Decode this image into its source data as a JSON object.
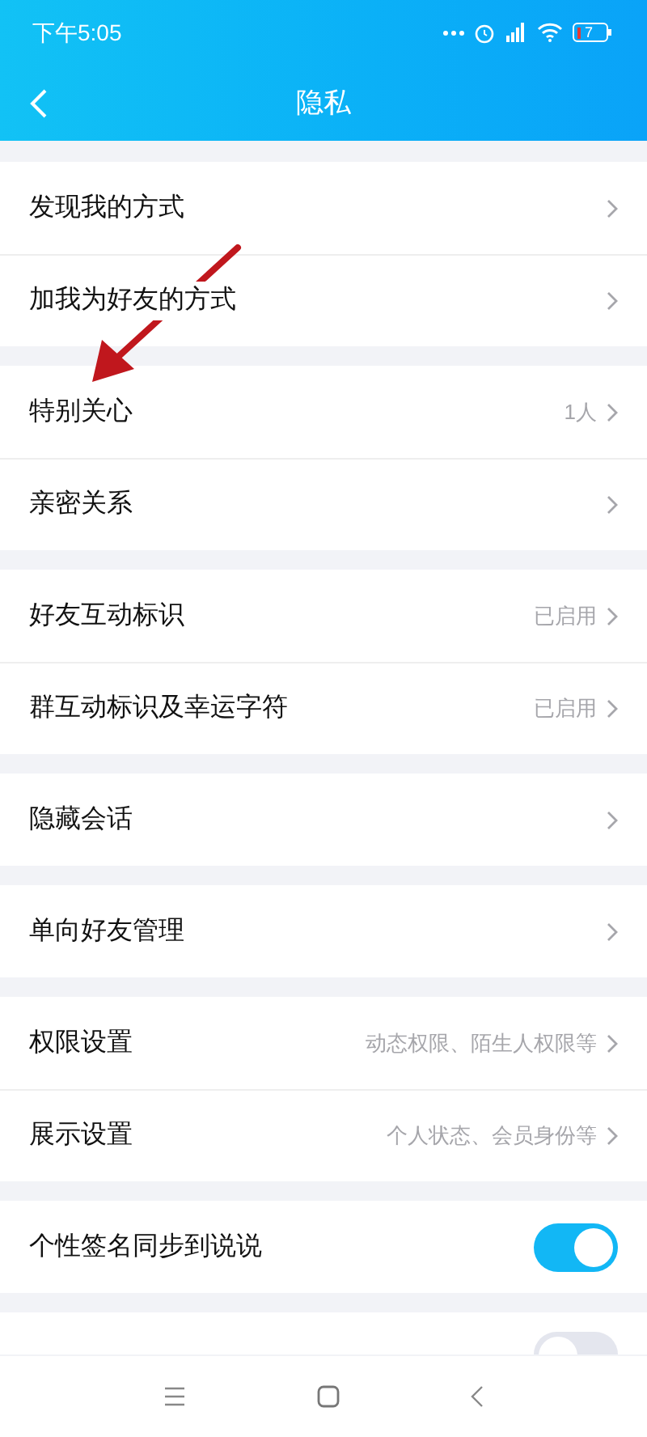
{
  "status_bar": {
    "time": "下午5:05",
    "battery": "7"
  },
  "header": {
    "title": "隐私"
  },
  "groups": [
    {
      "items": [
        {
          "kind": "link",
          "label": "发现我的方式"
        },
        {
          "kind": "link",
          "label": "加我为好友的方式"
        }
      ]
    },
    {
      "items": [
        {
          "kind": "link",
          "label": "特别关心",
          "value": "1人"
        },
        {
          "kind": "link",
          "label": "亲密关系"
        }
      ]
    },
    {
      "items": [
        {
          "kind": "link",
          "label": "好友互动标识",
          "value": "已启用"
        },
        {
          "kind": "link",
          "label": "群互动标识及幸运字符",
          "value": "已启用"
        }
      ]
    },
    {
      "items": [
        {
          "kind": "link",
          "label": "隐藏会话"
        }
      ]
    },
    {
      "items": [
        {
          "kind": "link",
          "label": "单向好友管理"
        }
      ]
    },
    {
      "items": [
        {
          "kind": "link",
          "label": "权限设置",
          "value": "动态权限、陌生人权限等"
        },
        {
          "kind": "link",
          "label": "展示设置",
          "value": "个人状态、会员身份等"
        }
      ]
    },
    {
      "items": [
        {
          "kind": "toggle",
          "label": "个性签名同步到说说",
          "on": true
        }
      ]
    },
    {
      "items": [
        {
          "kind": "toggle",
          "on": false
        }
      ]
    }
  ]
}
